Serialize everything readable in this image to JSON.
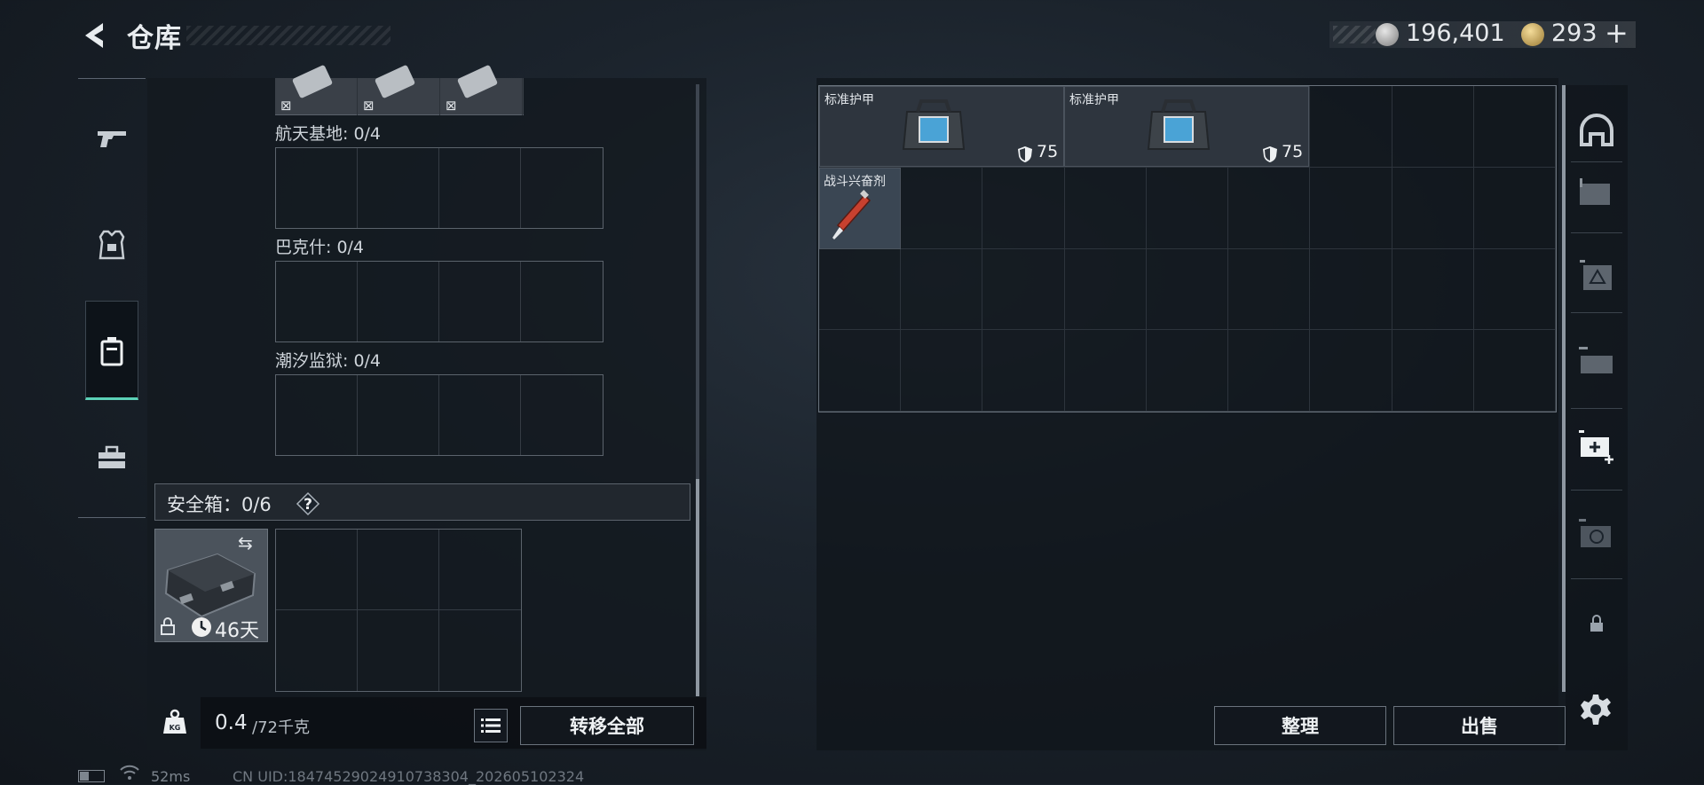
{
  "header": {
    "title": "仓库",
    "silver_amount": "196,401",
    "gold_amount": "293",
    "add_label": "+"
  },
  "sidebar": {
    "categories": [
      {
        "icon": "gun-icon",
        "active": false
      },
      {
        "icon": "armor-vest-icon",
        "active": false
      },
      {
        "icon": "backpack-icon",
        "active": true
      },
      {
        "icon": "toolbox-icon",
        "active": false
      }
    ]
  },
  "left_panel": {
    "top_item_marks": [
      "⊠",
      "⊠",
      "⊠"
    ],
    "slots": [
      {
        "label": "航天基地: 0/4"
      },
      {
        "label": "巴克什: 0/4"
      },
      {
        "label": "潮汐监狱: 0/4"
      }
    ],
    "safebox": {
      "label": "安全箱：0/6",
      "help": "?",
      "days": "46天"
    },
    "weight": {
      "current": "0.4",
      "max": "/72千克"
    },
    "transfer_all": "转移全部"
  },
  "storage": {
    "items": [
      {
        "name": "标准护甲",
        "value": "75"
      },
      {
        "name": "标准护甲",
        "value": "75"
      },
      {
        "name": "战斗兴奋剂"
      }
    ],
    "sort_label": "整理",
    "sell_label": "出售"
  },
  "right_tabs": [
    "helmet-tab-icon",
    "storage-1-icon",
    "storage-2-icon",
    "storage-3-icon",
    "storage-add-icon",
    "storage-4-icon",
    "lock-icon"
  ],
  "status_bar": {
    "ping": "52ms",
    "uid": "CN UID:18474529024910738304_202605102324"
  },
  "colors": {
    "accent": "#5bd1b7",
    "panel": "#141a20",
    "border": "#5b636c"
  }
}
